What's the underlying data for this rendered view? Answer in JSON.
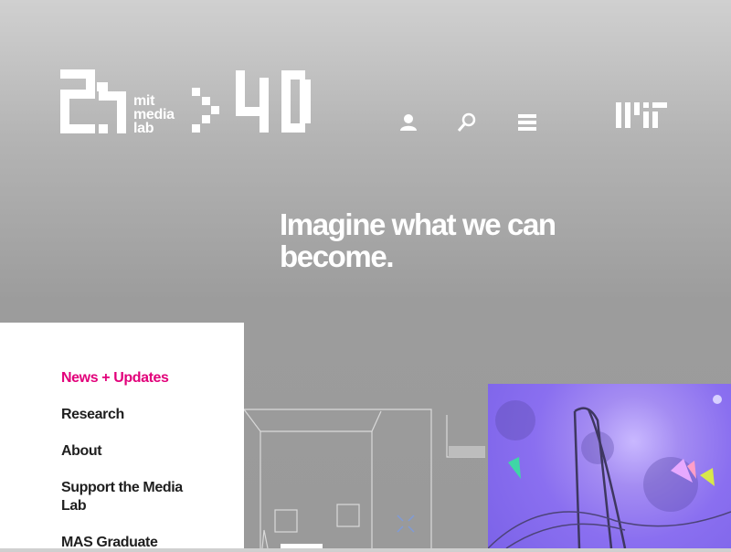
{
  "header": {
    "logo_text_line1": "mit",
    "logo_text_line2": "media",
    "logo_text_line3": "lab",
    "anniversary": "40"
  },
  "hero": {
    "line1": "Imagine what we can",
    "line2": "become."
  },
  "nav_icons": [
    "user-icon",
    "search-icon",
    "menu-icon"
  ],
  "menu": {
    "items": [
      {
        "label": "News + Updates",
        "active": true
      },
      {
        "label": "Research",
        "active": false
      },
      {
        "label": "About",
        "active": false
      },
      {
        "label": "Support the Media Lab",
        "active": false
      },
      {
        "label": "MAS Graduate",
        "active": false
      }
    ]
  },
  "colors": {
    "accent": "#e2007a",
    "menu_text": "#1f1f1f",
    "header_text": "#ffffff"
  }
}
